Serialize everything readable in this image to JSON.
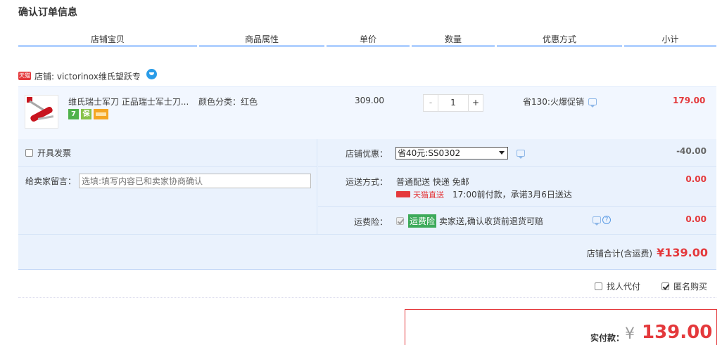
{
  "page_title": "确认订单信息",
  "columns": [
    "店铺宝贝",
    "商品属性",
    "单价",
    "数量",
    "优惠方式",
    "小计"
  ],
  "shop": {
    "badge": "天猫",
    "label": "店铺: victorinox维氏望跃专"
  },
  "item": {
    "title": "维氏瑞士军刀 正品瑞士军士刀...",
    "attr": "颜色分类：红色",
    "price": "309.00",
    "quantity": "1",
    "qty_minus": "-",
    "qty_plus": "+",
    "promo": "省130:火爆促销",
    "subtotal": "179.00",
    "svc_icons": [
      "7",
      "保",
      "card"
    ]
  },
  "invoice": {
    "label": "开具发票",
    "checked": false
  },
  "message": {
    "label": "给卖家留言：",
    "placeholder": "选填:填写内容已和卖家协商确认"
  },
  "coupon": {
    "label": "店铺优惠：",
    "selected": "省40元:SS0302",
    "amount": "-40.00"
  },
  "shipping": {
    "label": "运送方式：",
    "method": "普通配送 快递 免邮",
    "tmall_fast": "天猫直送",
    "eta": "17:00前付款，承诺3月6日送达",
    "amount": "0.00"
  },
  "insurance": {
    "label": "运费险：",
    "badge": "运费险",
    "desc": "卖家送,确认收货前退货可赔",
    "amount": "0.00",
    "checked": true
  },
  "shop_total": {
    "label": "店铺合计(含运费)",
    "value": "¥139.00"
  },
  "options": {
    "proxy_pay": {
      "label": "找人代付",
      "checked": false
    },
    "anonymous": {
      "label": "匿名购买",
      "checked": true
    }
  },
  "payment": {
    "label": "实付款：",
    "currency": "¥",
    "value": "139.00"
  },
  "colors": {
    "accent_red": "#e4393c",
    "header_rule": "#b2d1ff",
    "row_bg": "#f2f7ff",
    "detail_bg": "#eaf2fd"
  }
}
